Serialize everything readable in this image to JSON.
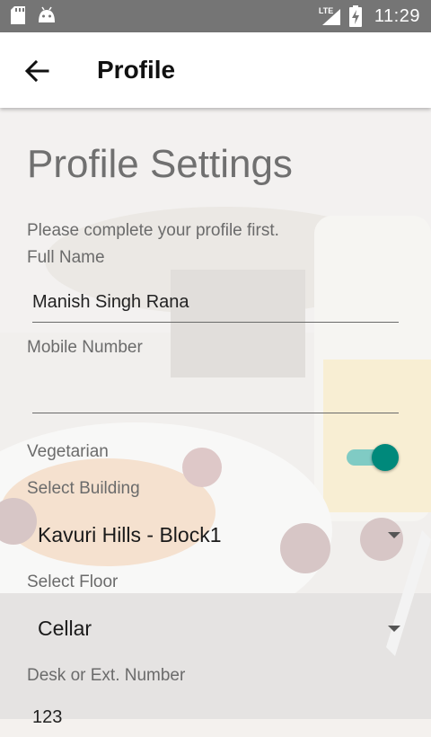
{
  "status_bar": {
    "time": "11:29",
    "network": "LTE",
    "icons": [
      "sd-card-icon",
      "android-icon",
      "lte-signal-icon",
      "battery-charging-icon"
    ]
  },
  "toolbar": {
    "title": "Profile",
    "back_icon": "arrow-left-icon"
  },
  "page": {
    "heading": "Profile Settings",
    "hint": "Please complete your profile first."
  },
  "form": {
    "full_name_label": "Full Name",
    "full_name_value": "Manish Singh Rana",
    "mobile_label": "Mobile Number",
    "mobile_value": "",
    "vegetarian_label": "Vegetarian",
    "vegetarian_on": true,
    "building_label": "Select Building",
    "building_value": "Kavuri Hills - Block1",
    "floor_label": "Select Floor",
    "floor_value": "Cellar",
    "desk_label": "Desk or Ext. Number",
    "desk_value": "123"
  },
  "colors": {
    "status_bar": "#757575",
    "accent": "#00897b",
    "accent_light": "#80cbc4"
  }
}
